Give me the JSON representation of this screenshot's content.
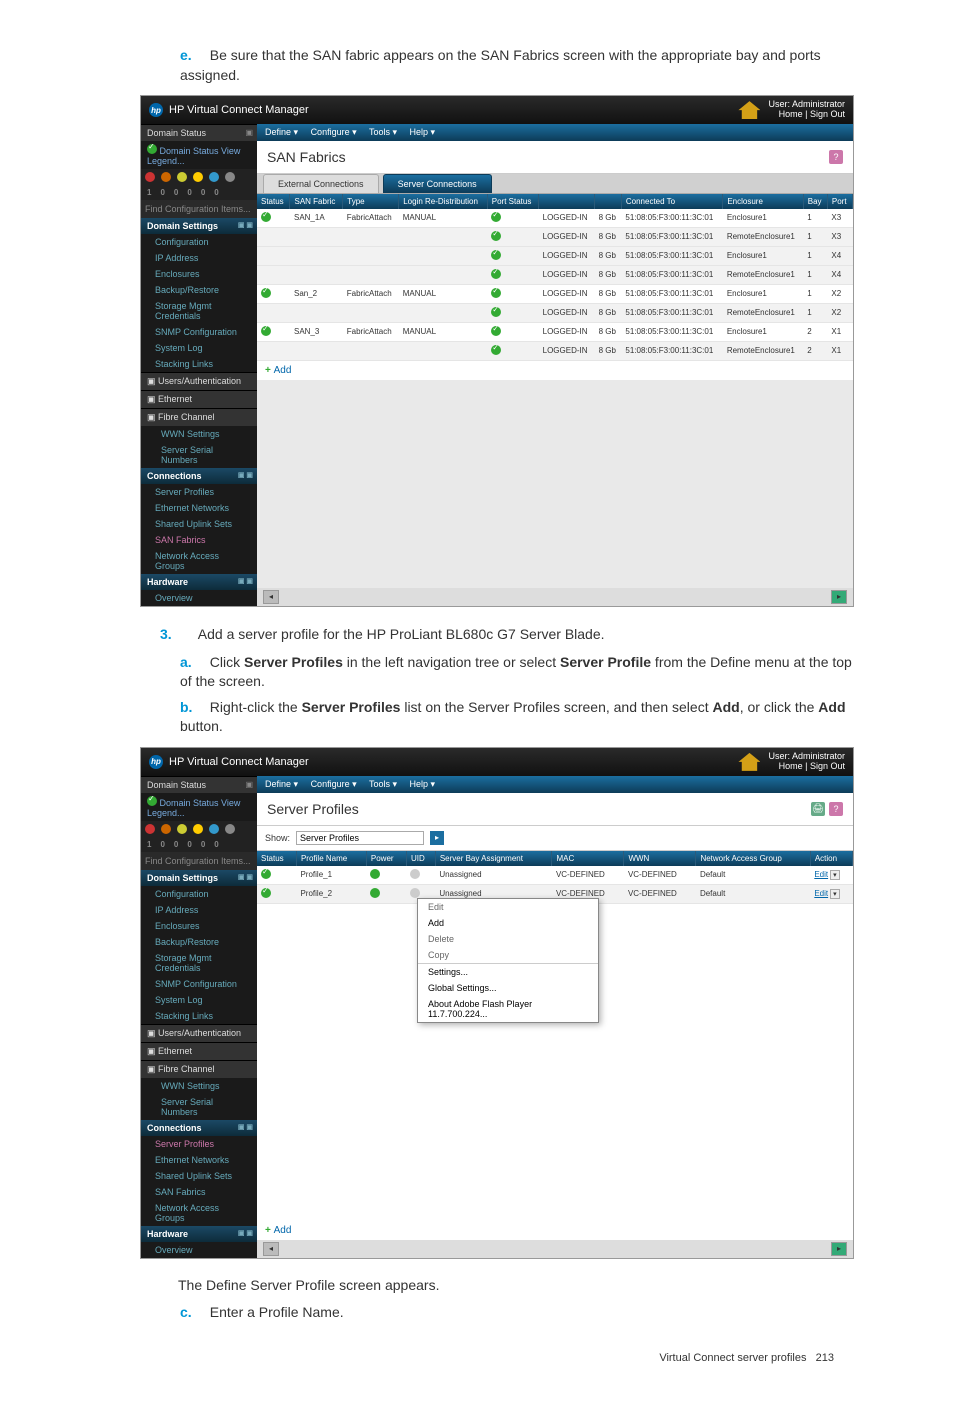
{
  "instructions": {
    "e": "Be sure that the SAN fabric appears on the SAN Fabrics screen with the appropriate bay and ports assigned.",
    "num3": "Add a server profile for the HP ProLiant BL680c G7 Server Blade.",
    "a_pre": "Click ",
    "a_b1": "Server Profiles",
    "a_mid": " in the left navigation tree or select ",
    "a_b2": "Server Profile",
    "a_post": " from the Define menu at the top of the screen.",
    "b_pre": "Right-click the ",
    "b_b1": "Server Profiles",
    "b_mid": " list on the Server Profiles screen, and then select ",
    "b_b2": "Add",
    "b_mid2": ", or click the ",
    "b_b3": "Add",
    "b_post": " button.",
    "post_define": "The Define Server Profile screen appears.",
    "c": "Enter a Profile Name."
  },
  "vcm": {
    "app_title": "HP Virtual Connect Manager",
    "user_line1": "User: Administrator",
    "user_line2": "Home | Sign Out",
    "menu": {
      "define": "Define ▾",
      "configure": "Configure ▾",
      "tools": "Tools ▾",
      "help": "Help ▾"
    },
    "left": {
      "domain_status": "Domain Status",
      "status_legend": "Domain Status   View Legend...",
      "find": "Find Configuration Items...",
      "domain_settings": "Domain Settings",
      "items": [
        "Configuration",
        "IP Address",
        "Enclosures",
        "Backup/Restore",
        "Storage Mgmt Credentials",
        "SNMP Configuration",
        "System Log",
        "Stacking Links"
      ],
      "users_auth": "Users/Authentication",
      "ethernet": "Ethernet",
      "fibre": "Fibre Channel",
      "fibre_items": [
        "WWN Settings",
        "Server Serial Numbers"
      ],
      "connections": "Connections",
      "conn_items": [
        "Server Profiles",
        "Ethernet Networks",
        "Shared Uplink Sets",
        "SAN Fabrics",
        "Network Access Groups"
      ],
      "hardware": "Hardware",
      "hw_items": [
        "Overview"
      ]
    }
  },
  "san": {
    "title": "SAN Fabrics",
    "tabs": {
      "ext": "External Connections",
      "srv": "Server Connections"
    },
    "cols": [
      "Status",
      "SAN Fabric",
      "Type",
      "Login Re-Distribution",
      "Port Status",
      "",
      "",
      "Connected To",
      "Enclosure",
      "Bay",
      "Port"
    ],
    "rows": [
      {
        "fab": "SAN_1A",
        "type": "FabricAttach",
        "login": "MANUAL",
        "port": "LOGGED-IN",
        "speed": "8 Gb",
        "wwn": "51:08:05:F3:00:11:3C:01",
        "enc": "Enclosure1",
        "bay": "1",
        "p": "X3"
      },
      {
        "fab": "",
        "type": "",
        "login": "",
        "port": "LOGGED-IN",
        "speed": "8 Gb",
        "wwn": "51:08:05:F3:00:11:3C:01",
        "enc": "RemoteEnclosure1",
        "bay": "1",
        "p": "X3"
      },
      {
        "fab": "",
        "type": "",
        "login": "",
        "port": "LOGGED-IN",
        "speed": "8 Gb",
        "wwn": "51:08:05:F3:00:11:3C:01",
        "enc": "Enclosure1",
        "bay": "1",
        "p": "X4"
      },
      {
        "fab": "",
        "type": "",
        "login": "",
        "port": "LOGGED-IN",
        "speed": "8 Gb",
        "wwn": "51:08:05:F3:00:11:3C:01",
        "enc": "RemoteEnclosure1",
        "bay": "1",
        "p": "X4"
      },
      {
        "fab": "San_2",
        "type": "FabricAttach",
        "login": "MANUAL",
        "port": "LOGGED-IN",
        "speed": "8 Gb",
        "wwn": "51:08:05:F3:00:11:3C:01",
        "enc": "Enclosure1",
        "bay": "1",
        "p": "X2"
      },
      {
        "fab": "",
        "type": "",
        "login": "",
        "port": "LOGGED-IN",
        "speed": "8 Gb",
        "wwn": "51:08:05:F3:00:11:3C:01",
        "enc": "RemoteEnclosure1",
        "bay": "1",
        "p": "X2"
      },
      {
        "fab": "SAN_3",
        "type": "FabricAttach",
        "login": "MANUAL",
        "port": "LOGGED-IN",
        "speed": "8 Gb",
        "wwn": "51:08:05:F3:00:11:3C:01",
        "enc": "Enclosure1",
        "bay": "2",
        "p": "X1"
      },
      {
        "fab": "",
        "type": "",
        "login": "",
        "port": "LOGGED-IN",
        "speed": "8 Gb",
        "wwn": "51:08:05:F3:00:11:3C:01",
        "enc": "RemoteEnclosure1",
        "bay": "2",
        "p": "X1"
      }
    ],
    "add": "Add"
  },
  "profiles": {
    "title": "Server Profiles",
    "show": "Show:",
    "show_val": "Server Profiles",
    "cols": [
      "Status",
      "Profile Name",
      "Power",
      "UID",
      "Server Bay Assignment",
      "MAC",
      "WWN",
      "Network Access Group",
      "Action"
    ],
    "rows": [
      {
        "name": "Profile_1",
        "bay": "Unassigned",
        "mac": "VC-DEFINED",
        "wwn": "VC-DEFINED",
        "nag": "Default",
        "act": "Edit"
      },
      {
        "name": "Profile_2",
        "bay": "Unassigned",
        "mac": "VC-DEFINED",
        "wwn": "VC-DEFINED",
        "nag": "Default",
        "act": "Edit"
      }
    ],
    "ctx": [
      "Edit",
      "Add",
      "Delete",
      "Copy",
      "Settings...",
      "Global Settings...",
      "About Adobe Flash Player 11.7.700.224..."
    ],
    "add": "Add"
  },
  "footer": {
    "label": "Virtual Connect server profiles",
    "page": "213"
  }
}
